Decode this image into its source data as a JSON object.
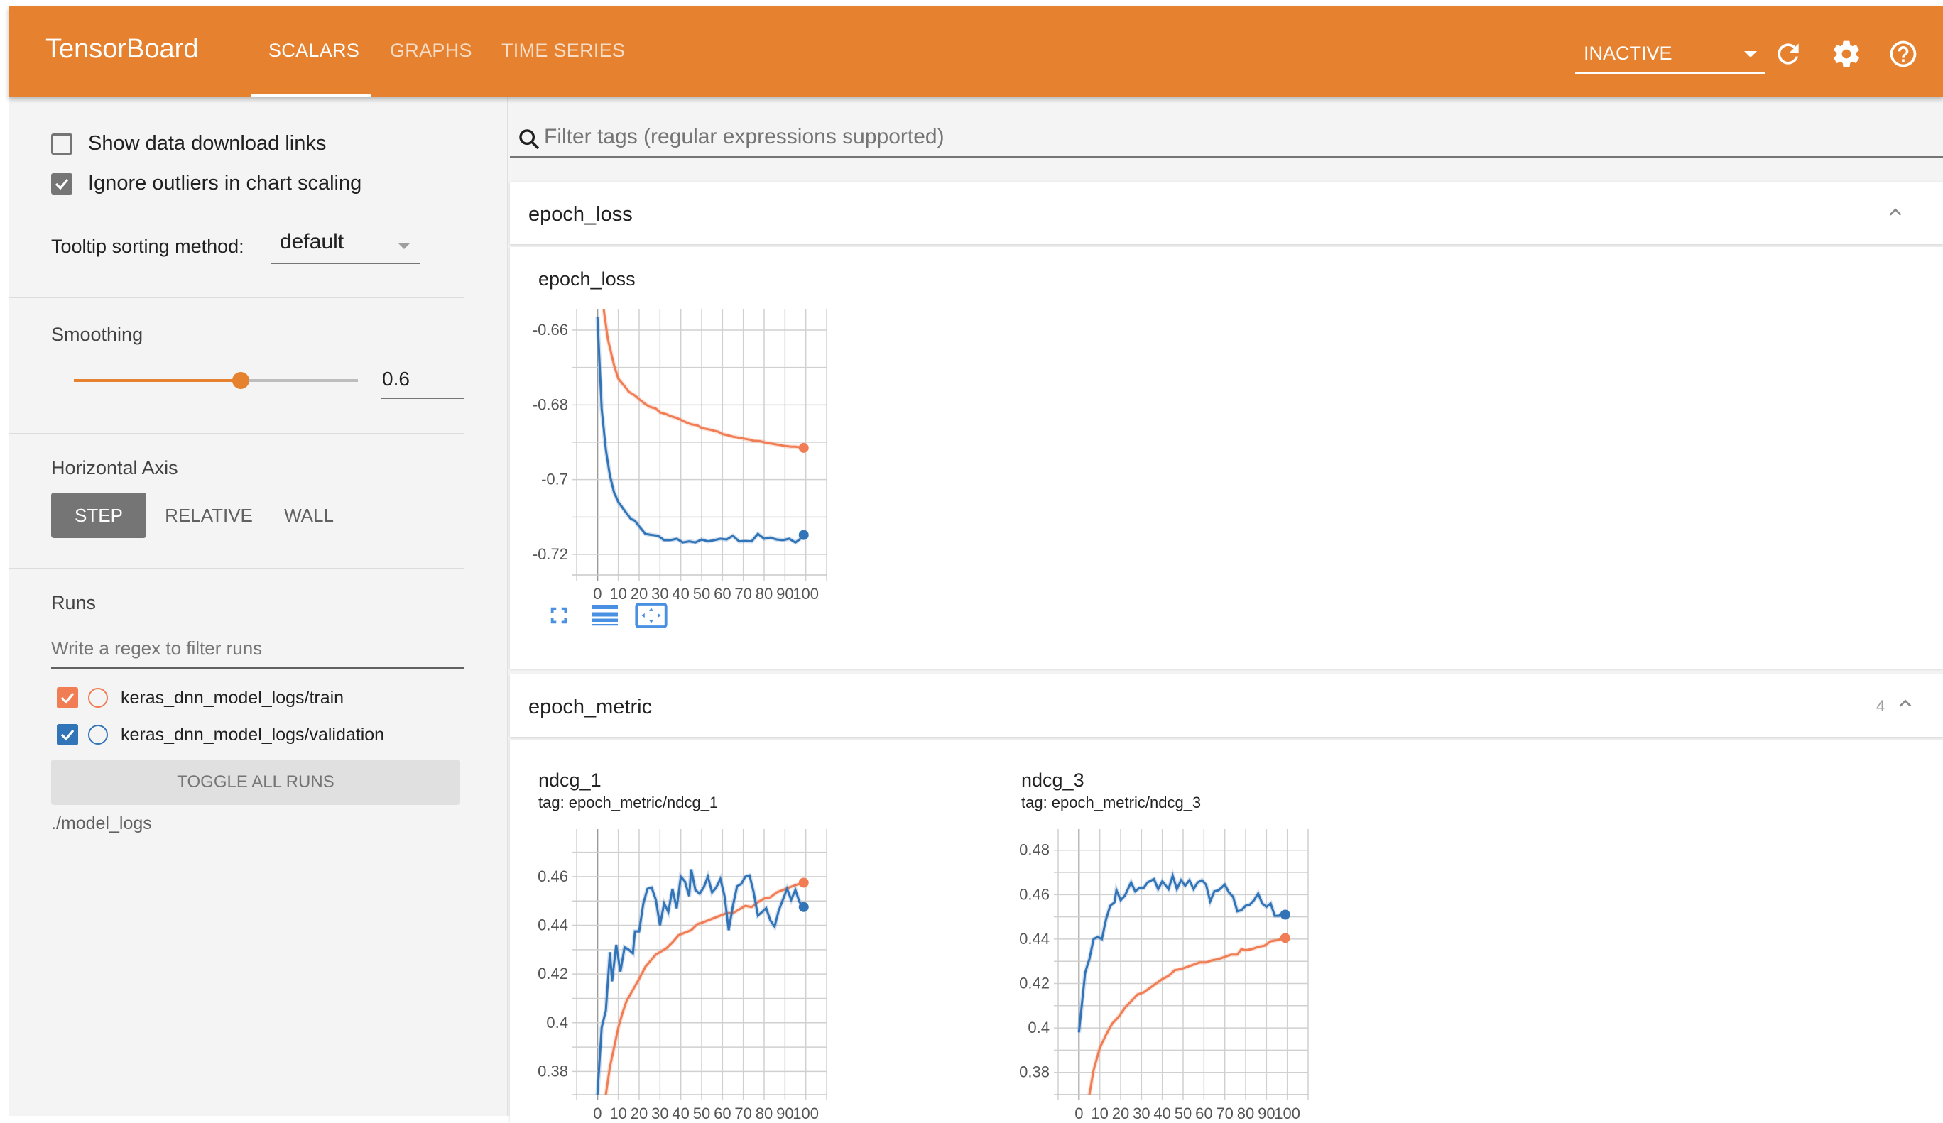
{
  "header": {
    "brand": "TensorBoard",
    "tabs": [
      {
        "label": "SCALARS",
        "active": true
      },
      {
        "label": "GRAPHS",
        "active": false
      },
      {
        "label": "TIME SERIES",
        "active": false
      }
    ],
    "run_status_select": "INACTIVE",
    "icons": [
      "refresh-icon",
      "gear-icon",
      "help-icon"
    ],
    "accent_color": "#E6822F"
  },
  "sidebar": {
    "show_download_links": {
      "label": "Show data download links",
      "checked": false
    },
    "ignore_outliers": {
      "label": "Ignore outliers in chart scaling",
      "checked": true
    },
    "tooltip_sorting": {
      "label": "Tooltip sorting method:",
      "value": "default"
    },
    "smoothing": {
      "label": "Smoothing",
      "value": 0.6,
      "value_text": "0.6"
    },
    "horizontal_axis": {
      "label": "Horizontal Axis",
      "options": [
        "STEP",
        "RELATIVE",
        "WALL"
      ],
      "selected": "STEP"
    },
    "runs": {
      "label": "Runs",
      "filter_placeholder": "Write a regex to filter runs",
      "items": [
        {
          "name": "keras_dnn_model_logs/train",
          "checked": true,
          "color": "#F07D54"
        },
        {
          "name": "keras_dnn_model_logs/validation",
          "checked": true,
          "color": "#3274B8"
        }
      ],
      "toggle_all_label": "TOGGLE ALL RUNS",
      "logdir": "./model_logs"
    }
  },
  "main": {
    "filter_placeholder": "Filter tags (regular expressions supported)",
    "sections": [
      {
        "title": "epoch_loss",
        "count": ""
      },
      {
        "title": "epoch_metric",
        "count": "4"
      }
    ],
    "chart_tools": [
      "fit-to-data-icon",
      "toggle-log-scale-icon",
      "pan-zoom-icon"
    ]
  },
  "chart_data": [
    {
      "type": "line",
      "title": "epoch_loss",
      "subtitle": "",
      "xlabel": "",
      "ylabel": "",
      "xlim": [
        -10,
        110
      ],
      "ylim": [
        -0.7255,
        -0.6545
      ],
      "xticks": [
        0,
        10,
        20,
        30,
        40,
        50,
        60,
        70,
        80,
        90,
        100
      ],
      "yticks": [
        -0.66,
        -0.68,
        -0.7,
        -0.72
      ],
      "ytick_labels": [
        "-0.66",
        "-0.68",
        "-0.7",
        "-0.72"
      ],
      "ygrid_step": 0.01,
      "grid": true,
      "series": [
        {
          "name": "keras_dnn_model_logs/train",
          "color": "#F07D54",
          "x": [
            3,
            5,
            8,
            10,
            13,
            15,
            18,
            20,
            23,
            25,
            28,
            30,
            33,
            35,
            38,
            40,
            43,
            45,
            48,
            50,
            53,
            55,
            58,
            60,
            63,
            65,
            68,
            70,
            73,
            75,
            78,
            80,
            83,
            85,
            88,
            90,
            93,
            95,
            99
          ],
          "values": [
            -0.6545,
            -0.6625,
            -0.6695,
            -0.673,
            -0.675,
            -0.6765,
            -0.6775,
            -0.6785,
            -0.6798,
            -0.6805,
            -0.681,
            -0.682,
            -0.6825,
            -0.683,
            -0.6835,
            -0.684,
            -0.6848,
            -0.6852,
            -0.6855,
            -0.6862,
            -0.6865,
            -0.6868,
            -0.6872,
            -0.6878,
            -0.6882,
            -0.6885,
            -0.6888,
            -0.689,
            -0.6893,
            -0.6896,
            -0.6897,
            -0.69,
            -0.6903,
            -0.6905,
            -0.6908,
            -0.691,
            -0.6912,
            -0.6912,
            -0.6915
          ]
        },
        {
          "name": "keras_dnn_model_logs/validation",
          "color": "#3274B8",
          "x": [
            0,
            2,
            4,
            6,
            8,
            10,
            12,
            14,
            16,
            18,
            20,
            23,
            26,
            29,
            32,
            35,
            38,
            41,
            44,
            47,
            50,
            53,
            56,
            59,
            62,
            65,
            68,
            71,
            74,
            77,
            80,
            83,
            86,
            89,
            92,
            95,
            97,
            99
          ],
          "values": [
            -0.6565,
            -0.681,
            -0.692,
            -0.699,
            -0.7035,
            -0.706,
            -0.7075,
            -0.709,
            -0.7105,
            -0.711,
            -0.7125,
            -0.7145,
            -0.7148,
            -0.715,
            -0.7162,
            -0.7162,
            -0.7158,
            -0.7168,
            -0.7165,
            -0.7168,
            -0.716,
            -0.7165,
            -0.7162,
            -0.7158,
            -0.716,
            -0.715,
            -0.7165,
            -0.7164,
            -0.7165,
            -0.7145,
            -0.7158,
            -0.7155,
            -0.716,
            -0.7162,
            -0.7158,
            -0.7168,
            -0.716,
            -0.7148
          ]
        }
      ]
    },
    {
      "type": "line",
      "title": "ndcg_1",
      "subtitle": "tag: epoch_metric/ndcg_1",
      "xlabel": "",
      "ylabel": "",
      "xlim": [
        -10,
        110
      ],
      "ylim": [
        0.3705,
        0.4795
      ],
      "xticks": [
        0,
        10,
        20,
        30,
        40,
        50,
        60,
        70,
        80,
        90,
        100
      ],
      "yticks": [
        0.38,
        0.4,
        0.42,
        0.44,
        0.46
      ],
      "ytick_labels": [
        "0.38",
        "0.4",
        "0.42",
        "0.44",
        "0.46"
      ],
      "ygrid_step": 0.01,
      "grid": true,
      "series": [
        {
          "name": "keras_dnn_model_logs/train",
          "color": "#F07D54",
          "x": [
            4,
            6,
            8,
            10,
            12,
            14,
            16,
            18,
            20,
            23,
            25,
            28,
            30,
            33,
            36,
            39,
            42,
            45,
            48,
            50,
            53,
            56,
            59,
            62,
            65,
            68,
            71,
            74,
            77,
            80,
            83,
            86,
            89,
            92,
            95,
            99
          ],
          "values": [
            0.3705,
            0.382,
            0.39,
            0.398,
            0.404,
            0.409,
            0.412,
            0.415,
            0.418,
            0.423,
            0.425,
            0.428,
            0.429,
            0.4305,
            0.433,
            0.436,
            0.437,
            0.438,
            0.4405,
            0.441,
            0.442,
            0.443,
            0.444,
            0.445,
            0.445,
            0.4465,
            0.448,
            0.4475,
            0.4495,
            0.451,
            0.4515,
            0.4535,
            0.4545,
            0.4555,
            0.4565,
            0.4575
          ]
        },
        {
          "name": "keras_dnn_model_logs/validation",
          "color": "#3274B8",
          "x": [
            0,
            2,
            4,
            6,
            7,
            9,
            11,
            13,
            15,
            17,
            18,
            20,
            22,
            24,
            26,
            28,
            30,
            32,
            34,
            36,
            38,
            40,
            42,
            44,
            45,
            47,
            49,
            51,
            53,
            55,
            57,
            59,
            61,
            63,
            65,
            67,
            69,
            71,
            73,
            75,
            77,
            79,
            81,
            83,
            85,
            87,
            89,
            91,
            93,
            95,
            97,
            99
          ],
          "values": [
            0.3705,
            0.398,
            0.405,
            0.429,
            0.417,
            0.432,
            0.421,
            0.431,
            0.43,
            0.4285,
            0.4375,
            0.4375,
            0.449,
            0.455,
            0.4555,
            0.4505,
            0.44,
            0.449,
            0.4455,
            0.455,
            0.447,
            0.46,
            0.458,
            0.452,
            0.463,
            0.4545,
            0.453,
            0.4555,
            0.46,
            0.4535,
            0.4555,
            0.459,
            0.452,
            0.438,
            0.448,
            0.456,
            0.457,
            0.46,
            0.4605,
            0.4535,
            0.444,
            0.4455,
            0.447,
            0.442,
            0.4395,
            0.446,
            0.4505,
            0.455,
            0.4505,
            0.4545,
            0.4495,
            0.4475
          ]
        }
      ]
    },
    {
      "type": "line",
      "title": "ndcg_3",
      "subtitle": "tag: epoch_metric/ndcg_3",
      "xlabel": "",
      "ylabel": "",
      "xlim": [
        -10,
        110
      ],
      "ylim": [
        0.37,
        0.4895
      ],
      "xticks": [
        0,
        10,
        20,
        30,
        40,
        50,
        60,
        70,
        80,
        90,
        100
      ],
      "yticks": [
        0.38,
        0.4,
        0.42,
        0.44,
        0.46,
        0.48
      ],
      "ytick_labels": [
        "0.38",
        "0.4",
        "0.42",
        "0.44",
        "0.46",
        "0.48"
      ],
      "ygrid_step": 0.01,
      "grid": true,
      "series": [
        {
          "name": "keras_dnn_model_logs/train",
          "color": "#F07D54",
          "x": [
            5,
            7,
            10,
            13,
            16,
            19,
            22,
            25,
            28,
            31,
            34,
            37,
            40,
            43,
            46,
            49,
            52,
            55,
            58,
            61,
            64,
            67,
            70,
            73,
            76,
            78,
            80,
            83,
            86,
            89,
            92,
            95,
            99
          ],
          "values": [
            0.37,
            0.381,
            0.391,
            0.397,
            0.402,
            0.405,
            0.409,
            0.412,
            0.415,
            0.416,
            0.418,
            0.42,
            0.422,
            0.4235,
            0.426,
            0.4265,
            0.4275,
            0.4285,
            0.4295,
            0.4295,
            0.4305,
            0.431,
            0.432,
            0.433,
            0.433,
            0.4355,
            0.435,
            0.4355,
            0.4365,
            0.437,
            0.439,
            0.4395,
            0.4405
          ]
        },
        {
          "name": "keras_dnn_model_logs/validation",
          "color": "#3274B8",
          "x": [
            0,
            3,
            5,
            7,
            9,
            11,
            13,
            15,
            17,
            18,
            20,
            22,
            25,
            27,
            29,
            31,
            33,
            36,
            38,
            40,
            43,
            45,
            47,
            49,
            51,
            53,
            55,
            57,
            59,
            61,
            63,
            65,
            67,
            70,
            72,
            74,
            76,
            78,
            80,
            82,
            84,
            86,
            88,
            90,
            92,
            94,
            96,
            98,
            99
          ],
          "values": [
            0.398,
            0.425,
            0.431,
            0.44,
            0.441,
            0.44,
            0.449,
            0.455,
            0.4565,
            0.462,
            0.4575,
            0.4595,
            0.4655,
            0.4615,
            0.463,
            0.463,
            0.4655,
            0.467,
            0.4625,
            0.466,
            0.4625,
            0.4685,
            0.4625,
            0.4665,
            0.464,
            0.4665,
            0.4625,
            0.4655,
            0.4665,
            0.4645,
            0.457,
            0.4615,
            0.462,
            0.4645,
            0.461,
            0.459,
            0.4525,
            0.453,
            0.455,
            0.4555,
            0.4575,
            0.4605,
            0.456,
            0.4545,
            0.456,
            0.4505,
            0.4505,
            0.452,
            0.451
          ]
        }
      ]
    }
  ]
}
